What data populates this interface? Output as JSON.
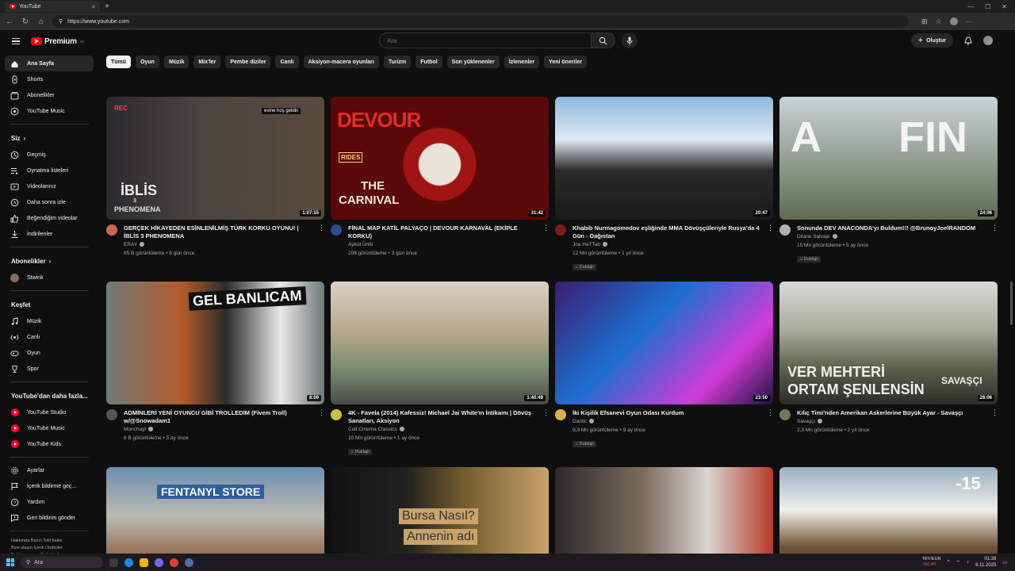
{
  "browser": {
    "tab_title": "YouTube",
    "url": "https://www.youtube.com"
  },
  "header": {
    "logo_text": "Premium",
    "logo_region": "TR",
    "search_placeholder": "Ara",
    "create_label": "Oluştur"
  },
  "chips": [
    "Tümü",
    "Oyun",
    "Müzik",
    "Mix'ler",
    "Pembe diziler",
    "Canlı",
    "Aksiyon-macera oyunları",
    "Turizm",
    "Futbol",
    "Son yüklenenler",
    "İzlenenler",
    "Yeni öneriler"
  ],
  "sidebar": {
    "main": [
      {
        "label": "Ana Sayfa",
        "icon": "home-icon"
      },
      {
        "label": "Shorts",
        "icon": "shorts-icon"
      },
      {
        "label": "Abonelikler",
        "icon": "subscriptions-icon"
      },
      {
        "label": "YouTube Music",
        "icon": "music-circle-icon"
      }
    ],
    "you_header": "Siz",
    "you": [
      {
        "label": "Geçmiş",
        "icon": "history-icon"
      },
      {
        "label": "Oynatma listeleri",
        "icon": "playlist-icon"
      },
      {
        "label": "Videolarınız",
        "icon": "your-videos-icon"
      },
      {
        "label": "Daha sonra izle",
        "icon": "watch-later-icon"
      },
      {
        "label": "Beğendiğim videolar",
        "icon": "like-icon"
      },
      {
        "label": "İndirilenler",
        "icon": "download-icon"
      }
    ],
    "subs_header": "Abonelikler",
    "subs": [
      {
        "label": "Stwink"
      }
    ],
    "explore_header": "Keşfet",
    "explore": [
      {
        "label": "Müzik",
        "icon": "music-note-icon"
      },
      {
        "label": "Canlı",
        "icon": "live-icon"
      },
      {
        "label": "Oyun",
        "icon": "gamepad-icon"
      },
      {
        "label": "Spor",
        "icon": "trophy-icon"
      }
    ],
    "more_header": "YouTube'dan daha fazla...",
    "more": [
      {
        "label": "YouTube Studio"
      },
      {
        "label": "YouTube Music"
      },
      {
        "label": "YouTube Kids"
      }
    ],
    "settings": [
      {
        "label": "Ayarlar",
        "icon": "settings-icon"
      },
      {
        "label": "İçerik bildirme geç...",
        "icon": "flag-icon"
      },
      {
        "label": "Yardım",
        "icon": "help-icon"
      },
      {
        "label": "Geri bildirim gönder",
        "icon": "feedback-icon"
      }
    ],
    "footer": [
      "Hakkında  Basın  Telif hakkı",
      "Bize ulaşın  İçerik Üreticiler",
      "Reklam verme  Geliştiriciler"
    ]
  },
  "videos": [
    {
      "title": "GERÇEK HİKAYEDEN ESİNLENİLMİŞ TÜRK KORKU OYUNU! | İBLİS 3 PHENOMENA",
      "channel": "ERAY",
      "stats": "95 B görüntüleme • 8 gün önce",
      "duration": "1:07:15",
      "badge": "",
      "verified": true,
      "thumb_text": [
        "REC",
        "evine hoş geldin",
        "İBLİS",
        "3",
        "PHENOMENA"
      ]
    },
    {
      "title": "FİNAL MAP KATİL PALYAÇO | DEVOUR KARNAVAL (EKİPLE KORKU)",
      "channel": "Aykut Ünlü",
      "stats": "206 görüntüleme • 3 gün önce",
      "duration": "31:42",
      "badge": "",
      "verified": false,
      "thumb_text": [
        "DEVOUR",
        "RIDES",
        "THE",
        "CARNIVAL"
      ]
    },
    {
      "title": "Khabib Nurmagomedov eşliğinde MMA Dövüşçüleriyle Rusya'da 4 Gün - Dağıstan",
      "channel": "Joe HaTTab",
      "stats": "12 Mn görüntüleme • 1 yıl önce",
      "duration": "20:47",
      "badge": "Dublajlı",
      "verified": true,
      "thumb_text": []
    },
    {
      "title": "Sonunda DEV ANACONDA'yı Buldum!!! @BrunoyJoelRANDOM",
      "channel": "Dilane Salvaje",
      "stats": "15 Mn görüntüleme • 5 ay önce",
      "duration": "24:06",
      "badge": "Dublajlı",
      "verified": true,
      "thumb_text": [
        "A",
        "FIN"
      ]
    },
    {
      "title": "ADMİNLERİ YENİ OYUNCU GİBİ TROLLEDİM (Fivem Troll) w/@Snowadam1",
      "channel": "Monchayl",
      "stats": "8 B görüntüleme • 5 ay önce",
      "duration": "8:09",
      "badge": "",
      "verified": true,
      "thumb_text": [
        "GEL BANLICAM"
      ]
    },
    {
      "title": "4K - Favela (2014) Kafessiz! Michael Jai White'ın İntikamı | Dövüş Sanatları, Aksiyon",
      "channel": "Cult Cinema Classics",
      "stats": "10 Mn görüntüleme • 1 ay önce",
      "duration": "1:40:49",
      "badge": "Dublajlı",
      "verified": true,
      "thumb_text": []
    },
    {
      "title": "İki Kişilik Efsanevi Oyun Odası Kurdum",
      "channel": "Dantic",
      "stats": "9,9 Mn görüntüleme • 9 ay önce",
      "duration": "23:50",
      "badge": "Dublajlı",
      "verified": true,
      "thumb_text": []
    },
    {
      "title": "Kılıç Timi'nden Amerikan Askerlerine Büyük Ayar - Savaşçı",
      "channel": "Savaşçı",
      "stats": "2,3 Mn görüntüleme • 2 yıl önce",
      "duration": "26:06",
      "badge": "",
      "verified": true,
      "thumb_text": [
        "VER MEHTERİ",
        "ORTAM ŞENLENSİN",
        "SAVAŞÇI"
      ]
    },
    {
      "title": "",
      "channel": "",
      "stats": "",
      "duration": "",
      "badge": "",
      "verified": false,
      "thumb_text": [
        "FENTANYL STORE"
      ]
    },
    {
      "title": "",
      "channel": "",
      "stats": "",
      "duration": "",
      "badge": "",
      "verified": false,
      "thumb_text": [
        "Bursa Nasıl?",
        "Annenin adı"
      ]
    },
    {
      "title": "",
      "channel": "",
      "stats": "",
      "duration": "",
      "badge": "",
      "verified": false,
      "thumb_text": []
    },
    {
      "title": "",
      "channel": "",
      "stats": "",
      "duration": "",
      "badge": "",
      "verified": false,
      "thumb_text": [
        "-15"
      ]
    }
  ],
  "taskbar": {
    "search_placeholder": "Ara",
    "fx_pair": "TRY/EUR",
    "fx_change": "-%0,49",
    "time": "01:38",
    "date": "8.11.2025"
  },
  "colors": {
    "accent": "#ff0000",
    "bg": "#0f0f0f",
    "chip": "#272727"
  }
}
